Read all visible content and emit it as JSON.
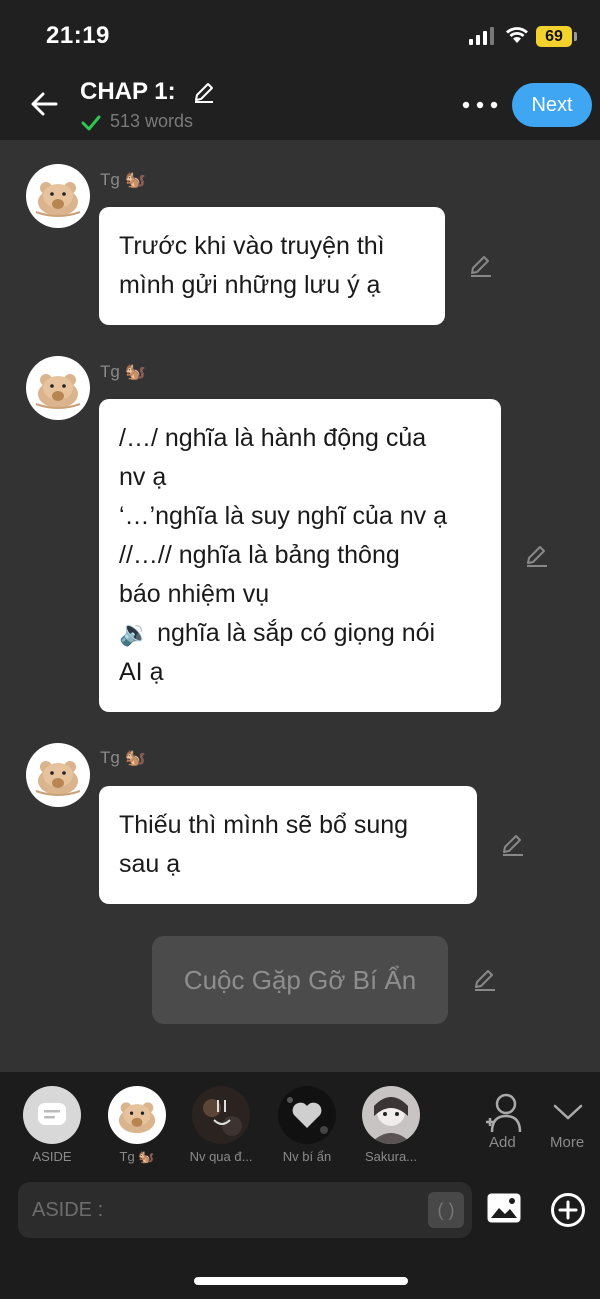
{
  "status_bar": {
    "time": "21:19",
    "battery": "69"
  },
  "header": {
    "title": "CHAP 1:",
    "word_count": "513 words",
    "next_label": "Next"
  },
  "messages": [
    {
      "sender": "Tg 🐿️",
      "lines": [
        "Trước khi vào truyện thì",
        "mình gửi những lưu ý ạ"
      ]
    },
    {
      "sender": "Tg 🐿️",
      "lines": [
        "/…/ nghĩa là hành động của",
        "nv ạ",
        "‘…’nghĩa là suy nghĩ của nv ạ",
        "//…// nghĩa là bảng thông",
        "báo nhiệm vụ",
        "🔉 nghĩa là sắp có giọng nói",
        "AI ạ"
      ]
    },
    {
      "sender": "Tg 🐿️",
      "lines": [
        "Thiếu thì mình sẽ bổ sung",
        "sau ạ"
      ]
    }
  ],
  "aside_text": "Cuộc Gặp Gỡ Bí Ẩn",
  "characters": [
    {
      "label": "ASIDE"
    },
    {
      "label": "Tg 🐿️"
    },
    {
      "label": "Nv qua đ..."
    },
    {
      "label": "Nv bí ẩn"
    },
    {
      "label": "Sakura..."
    }
  ],
  "tools": {
    "add_label": "Add",
    "more_label": "More"
  },
  "input": {
    "placeholder": "ASIDE :",
    "paren": "( )"
  },
  "colors": {
    "accent": "#3ea6f2",
    "background": "#333333",
    "panel": "#1c1c1c"
  }
}
